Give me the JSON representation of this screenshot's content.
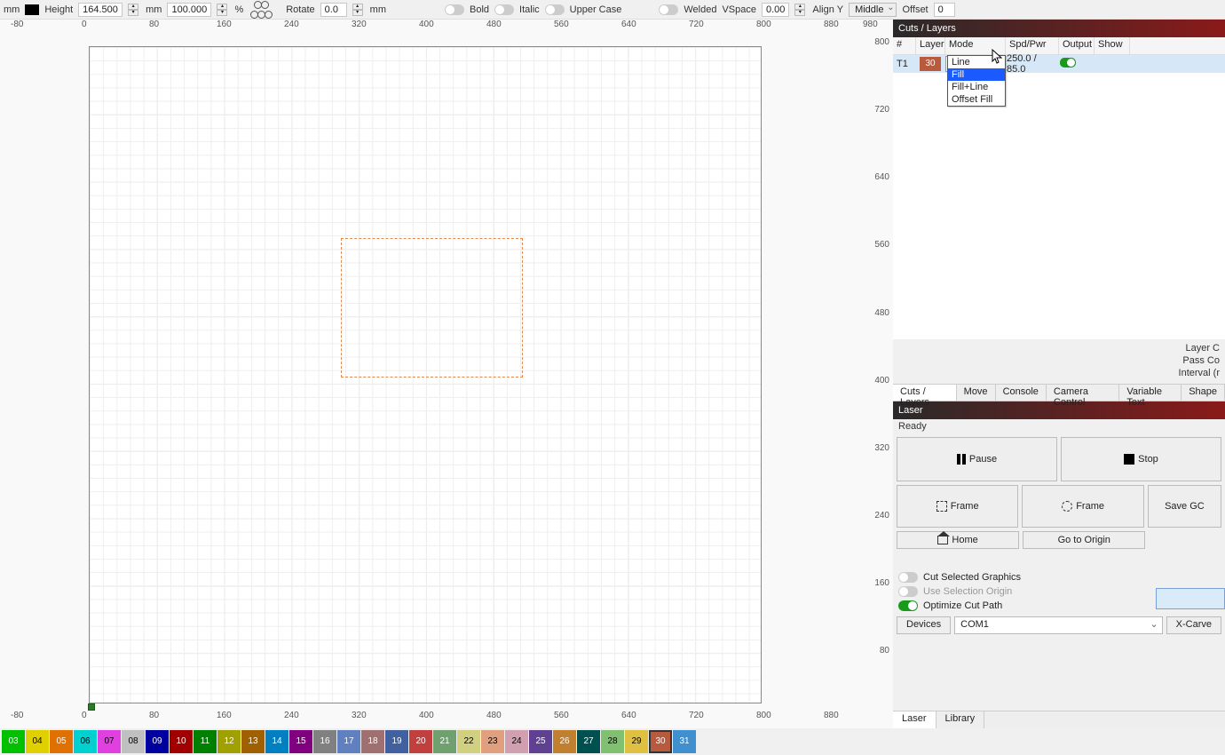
{
  "toolbar": {
    "height_label": "Height",
    "height_value": "164.500",
    "unit_mm1": "mm",
    "unit_mm2": "mm",
    "percent_value": "100.000",
    "unit_pct": "%",
    "rotate_label": "Rotate",
    "rotate_value": "0.0",
    "unit_mm3": "mm",
    "bold": "Bold",
    "italic": "Italic",
    "upper": "Upper Case",
    "welded": "Welded",
    "vspace": "VSpace",
    "vspace_val": "0.00",
    "aligny": "Align Y",
    "aligny_val": "Middle",
    "offset": "Offset",
    "offset_val": "0"
  },
  "rulers": {
    "top": [
      "-80",
      "0",
      "80",
      "160",
      "240",
      "320",
      "400",
      "480",
      "560",
      "640",
      "720",
      "800",
      "880",
      "980"
    ],
    "bottom": [
      "-80",
      "0",
      "80",
      "160",
      "240",
      "320",
      "400",
      "480",
      "560",
      "640",
      "720",
      "800",
      "880"
    ],
    "right": [
      "800",
      "720",
      "640",
      "560",
      "480",
      "400",
      "320",
      "240",
      "160",
      "80"
    ]
  },
  "cuts": {
    "title": "Cuts / Layers",
    "headers": {
      "hash": "#",
      "layer": "Layer",
      "mode": "Mode",
      "spd": "Spd/Pwr",
      "output": "Output",
      "show": "Show"
    },
    "rows": [
      {
        "id": "T1",
        "num": "30",
        "color": "#b85a3e",
        "mode": "Fill",
        "spdpwr": "250.0 / 85.0"
      }
    ],
    "dropdown": [
      "Line",
      "Fill",
      "Fill+Line",
      "Offset Fill"
    ],
    "dropdown_selected": "Fill",
    "props": [
      "Layer C",
      "Pass Co",
      "Interval (r"
    ]
  },
  "tabs": [
    "Cuts / Layers",
    "Move",
    "Console",
    "Camera Control",
    "Variable Text",
    "Shape"
  ],
  "laser": {
    "title": "Laser",
    "status": "Ready",
    "pause": "Pause",
    "stop": "Stop",
    "frame1": "Frame",
    "frame2": "Frame",
    "savegc": "Save GC",
    "home": "Home",
    "origin": "Go to Origin",
    "cut_sel": "Cut Selected Graphics",
    "use_sel": "Use Selection Origin",
    "opt_cut": "Optimize Cut Path",
    "devices": "Devices",
    "port": "COM1",
    "device": "X-Carve"
  },
  "bottom_tabs": [
    "Laser",
    "Library"
  ],
  "palette": [
    {
      "n": "03",
      "c": "#00c000"
    },
    {
      "n": "04",
      "c": "#e0d000"
    },
    {
      "n": "05",
      "c": "#e07000"
    },
    {
      "n": "06",
      "c": "#00d0d0"
    },
    {
      "n": "07",
      "c": "#e040e0"
    },
    {
      "n": "08",
      "c": "#c0c0c0"
    },
    {
      "n": "09",
      "c": "#0000a0"
    },
    {
      "n": "10",
      "c": "#a00000"
    },
    {
      "n": "11",
      "c": "#008000"
    },
    {
      "n": "12",
      "c": "#a0a000"
    },
    {
      "n": "13",
      "c": "#a06000"
    },
    {
      "n": "14",
      "c": "#0080c0"
    },
    {
      "n": "15",
      "c": "#800080"
    },
    {
      "n": "16",
      "c": "#808080"
    },
    {
      "n": "17",
      "c": "#6080c0"
    },
    {
      "n": "18",
      "c": "#a07070"
    },
    {
      "n": "19",
      "c": "#4060a0"
    },
    {
      "n": "20",
      "c": "#c04040"
    },
    {
      "n": "21",
      "c": "#70a070"
    },
    {
      "n": "22",
      "c": "#d0d080"
    },
    {
      "n": "23",
      "c": "#e0a080"
    },
    {
      "n": "24",
      "c": "#d0a0b0"
    },
    {
      "n": "25",
      "c": "#604090"
    },
    {
      "n": "26",
      "c": "#c08030"
    },
    {
      "n": "27",
      "c": "#005050"
    },
    {
      "n": "28",
      "c": "#80c070"
    },
    {
      "n": "29",
      "c": "#e0c040"
    },
    {
      "n": "30",
      "c": "#b85a3e"
    },
    {
      "n": "31",
      "c": "#4090d0"
    }
  ]
}
